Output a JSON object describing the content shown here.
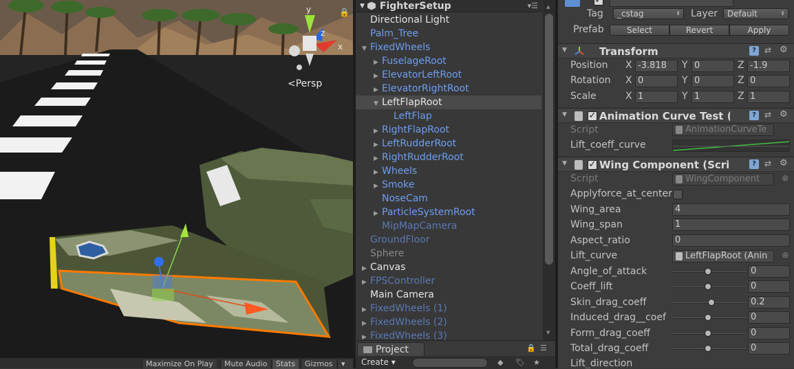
{
  "scene": {
    "persp_label": "Persp",
    "gizmo_axes": {
      "y": "y",
      "z": "z",
      "x": "x"
    },
    "bottom_bar": {
      "maximize": "Maximize On Play",
      "mute": "Mute Audio",
      "stats": "Stats",
      "gizmos": "Gizmos"
    }
  },
  "hierarchy": {
    "title": "FighterSetup",
    "items": [
      {
        "label": "Directional Light",
        "color": "white",
        "indent": 0,
        "arrow": ""
      },
      {
        "label": "Palm_Tree",
        "color": "blue",
        "indent": 0,
        "arrow": ""
      },
      {
        "label": "FixedWheels",
        "color": "blue",
        "indent": 0,
        "arrow": "▼"
      },
      {
        "label": "FuselageRoot",
        "color": "blue",
        "indent": 1,
        "arrow": "▶"
      },
      {
        "label": "ElevatorLeftRoot",
        "color": "blue",
        "indent": 1,
        "arrow": "▶"
      },
      {
        "label": "ElevatorRightRoot",
        "color": "blue",
        "indent": 1,
        "arrow": "▶"
      },
      {
        "label": "LeftFlapRoot",
        "color": "white",
        "indent": 1,
        "arrow": "▼",
        "selected": true
      },
      {
        "label": "LeftFlap",
        "color": "blue",
        "indent": 2,
        "arrow": ""
      },
      {
        "label": "RightFlapRoot",
        "color": "blue",
        "indent": 1,
        "arrow": "▶"
      },
      {
        "label": "LeftRudderRoot",
        "color": "blue",
        "indent": 1,
        "arrow": "▶"
      },
      {
        "label": "RightRudderRoot",
        "color": "blue",
        "indent": 1,
        "arrow": "▶"
      },
      {
        "label": "Wheels",
        "color": "blue",
        "indent": 1,
        "arrow": "▶"
      },
      {
        "label": "Smoke",
        "color": "blue",
        "indent": 1,
        "arrow": "▶"
      },
      {
        "label": "NoseCam",
        "color": "blue",
        "indent": 1,
        "arrow": ""
      },
      {
        "label": "ParticleSystemRoot",
        "color": "blue",
        "indent": 1,
        "arrow": "▶"
      },
      {
        "label": "MipMapCamera",
        "color": "bluefade",
        "indent": 1,
        "arrow": ""
      },
      {
        "label": "GroundFloor",
        "color": "bluefade",
        "indent": 0,
        "arrow": ""
      },
      {
        "label": "Sphere",
        "color": "gray",
        "indent": 0,
        "arrow": ""
      },
      {
        "label": "Canvas",
        "color": "white",
        "indent": 0,
        "arrow": "▶"
      },
      {
        "label": "FPSController",
        "color": "bluefade",
        "indent": 0,
        "arrow": "▶"
      },
      {
        "label": "Main Camera",
        "color": "white",
        "indent": 0,
        "arrow": ""
      },
      {
        "label": "FixedWheels (1)",
        "color": "bluefade",
        "indent": 0,
        "arrow": "▶"
      },
      {
        "label": "FixedWheels (2)",
        "color": "bluefade",
        "indent": 0,
        "arrow": "▶"
      },
      {
        "label": "FixedWheels (3)",
        "color": "bluefade",
        "indent": 0,
        "arrow": "▶"
      }
    ]
  },
  "project": {
    "tab": "Project",
    "create": "Create ▾"
  },
  "inspector": {
    "tag_label": "Tag",
    "tag_value": "_cstag",
    "layer_label": "Layer",
    "layer_value": "Default",
    "prefab_label": "Prefab",
    "prefab_buttons": {
      "select": "Select",
      "revert": "Revert",
      "apply": "Apply"
    },
    "transform": {
      "title": "Transform",
      "position": {
        "label": "Position",
        "x": "-3.818",
        "y": "0",
        "z": "-1.9"
      },
      "rotation": {
        "label": "Rotation",
        "x": "0",
        "y": "0",
        "z": "0"
      },
      "scale": {
        "label": "Scale",
        "x": "1",
        "y": "1",
        "z": "1"
      },
      "axis_x": "X",
      "axis_y": "Y",
      "axis_z": "Z"
    },
    "anim_curve": {
      "title": "Animation Curve Test (S",
      "script_label": "Script",
      "script_value": "AnimationCurveTe",
      "curve_label": "Lift_coeff_curve"
    },
    "wing": {
      "title": "Wing Component (Scrip",
      "script_label": "Script",
      "script_value": "WingComponent",
      "applyforce_label": "Applyforce_at_center",
      "wing_area_label": "Wing_area",
      "wing_area": "4",
      "wing_span_label": "Wing_span",
      "wing_span": "1",
      "aspect_ratio_label": "Aspect_ratio",
      "aspect_ratio": "0",
      "lift_curve_label": "Lift_curve",
      "lift_curve": "LeftFlapRoot (Anin",
      "angle_label": "Angle_of_attack",
      "angle": "0",
      "coeff_lift_label": "Coeff_lift",
      "coeff_lift": "0",
      "skin_drag_label": "Skin_drag_coeff",
      "skin_drag": "0.2",
      "induced_drag_label": "Induced_drag__coef",
      "induced_drag": "0",
      "form_drag_label": "Form_drag_coeff",
      "form_drag": "0",
      "total_drag_label": "Total_drag_coeff",
      "total_drag": "0",
      "lift_dir_label": "Lift_direction"
    }
  }
}
